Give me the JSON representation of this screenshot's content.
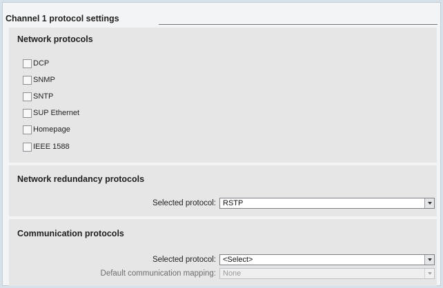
{
  "panel": {
    "title": "Channel 1 protocol settings"
  },
  "network_protocols": {
    "heading": "Network protocols",
    "items": [
      {
        "label": "DCP",
        "checked": false
      },
      {
        "label": "SNMP",
        "checked": false
      },
      {
        "label": "SNTP",
        "checked": false
      },
      {
        "label": "SUP Ethernet",
        "checked": false
      },
      {
        "label": "Homepage",
        "checked": false
      },
      {
        "label": "IEEE 1588",
        "checked": false
      }
    ]
  },
  "redundancy": {
    "heading": "Network redundancy protocols",
    "selected_label": "Selected protocol:",
    "selected_value": "RSTP"
  },
  "communication": {
    "heading": "Communication protocols",
    "selected_label": "Selected protocol:",
    "selected_value": "<Select>",
    "mapping_label": "Default communication mapping:",
    "mapping_value": "None",
    "mapping_disabled": true
  }
}
